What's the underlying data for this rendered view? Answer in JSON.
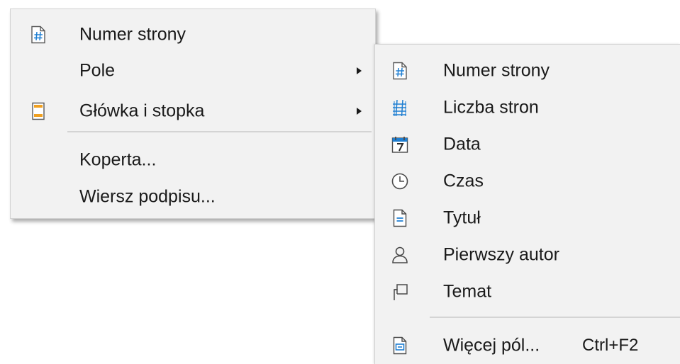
{
  "main_menu": {
    "items": [
      {
        "label": "Numer strony",
        "icon": "page-number-icon"
      },
      {
        "label": "Pole",
        "has_submenu": true
      },
      {
        "label": "Główka i stopka",
        "icon": "header-footer-icon",
        "has_submenu": true
      },
      {
        "label": "Koperta..."
      },
      {
        "label": "Wiersz podpisu..."
      }
    ]
  },
  "field_submenu": {
    "items": [
      {
        "label": "Numer strony",
        "icon": "page-number-icon"
      },
      {
        "label": "Liczba stron",
        "icon": "page-count-icon"
      },
      {
        "label": "Data",
        "icon": "calendar-icon"
      },
      {
        "label": "Czas",
        "icon": "clock-icon"
      },
      {
        "label": "Tytuł",
        "icon": "title-document-icon"
      },
      {
        "label": "Pierwszy autor",
        "icon": "person-icon"
      },
      {
        "label": "Temat",
        "icon": "subject-flag-icon"
      },
      {
        "label": "Więcej pól...",
        "icon": "more-fields-icon",
        "shortcut": "Ctrl+F2"
      }
    ]
  },
  "colors": {
    "menu_background": "#f2f2f2",
    "separator": "#d4d4d4",
    "icon_blue": "#1f7fd2",
    "icon_orange": "#f0a020",
    "text": "#1a1a1a"
  }
}
